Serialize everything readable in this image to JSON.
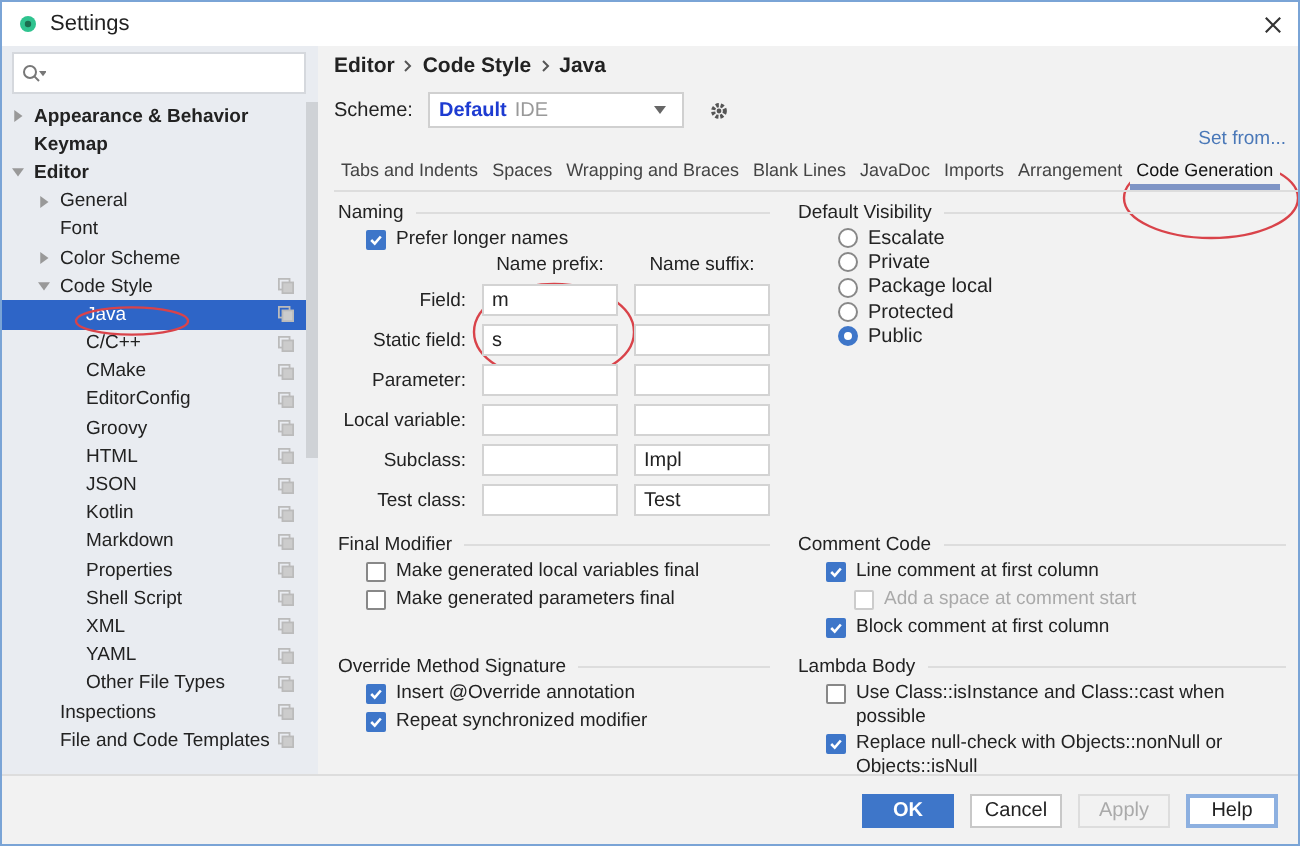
{
  "window": {
    "title": "Settings"
  },
  "sidebar": {
    "items": [
      {
        "label": "Appearance & Behavior",
        "expanded": false,
        "selected": false
      },
      {
        "label": "Keymap",
        "selected": false
      },
      {
        "label": "Editor",
        "expanded": true,
        "selected": false,
        "children": [
          {
            "label": "General",
            "expanded": false,
            "selected": false
          },
          {
            "label": "Font",
            "selected": false
          },
          {
            "label": "Color Scheme",
            "expanded": false,
            "selected": false
          },
          {
            "label": "Code Style",
            "expanded": true,
            "selected": false,
            "scheme_icon": true,
            "children": [
              {
                "label": "Java",
                "selected": true,
                "scheme_icon": true
              },
              {
                "label": "C/C++",
                "selected": false,
                "scheme_icon": true
              },
              {
                "label": "CMake",
                "selected": false,
                "scheme_icon": true
              },
              {
                "label": "EditorConfig",
                "selected": false,
                "scheme_icon": true
              },
              {
                "label": "Groovy",
                "selected": false,
                "scheme_icon": true
              },
              {
                "label": "HTML",
                "selected": false,
                "scheme_icon": true
              },
              {
                "label": "JSON",
                "selected": false,
                "scheme_icon": true
              },
              {
                "label": "Kotlin",
                "selected": false,
                "scheme_icon": true
              },
              {
                "label": "Markdown",
                "selected": false,
                "scheme_icon": true
              },
              {
                "label": "Properties",
                "selected": false,
                "scheme_icon": true
              },
              {
                "label": "Shell Script",
                "selected": false,
                "scheme_icon": true
              },
              {
                "label": "XML",
                "selected": false,
                "scheme_icon": true
              },
              {
                "label": "YAML",
                "selected": false,
                "scheme_icon": true
              },
              {
                "label": "Other File Types",
                "selected": false,
                "scheme_icon": true
              }
            ]
          },
          {
            "label": "Inspections",
            "selected": false,
            "scheme_icon": true
          },
          {
            "label": "File and Code Templates",
            "selected": false,
            "scheme_icon": true
          }
        ]
      }
    ]
  },
  "breadcrumb": [
    "Editor",
    "Code Style",
    "Java"
  ],
  "scheme": {
    "label": "Scheme:",
    "name": "Default",
    "tag": "IDE"
  },
  "set_from": "Set from...",
  "tabs": [
    {
      "label": "Tabs and Indents",
      "selected": false
    },
    {
      "label": "Spaces",
      "selected": false
    },
    {
      "label": "Wrapping and Braces",
      "selected": false
    },
    {
      "label": "Blank Lines",
      "selected": false
    },
    {
      "label": "JavaDoc",
      "selected": false
    },
    {
      "label": "Imports",
      "selected": false
    },
    {
      "label": "Arrangement",
      "selected": false
    },
    {
      "label": "Code Generation",
      "selected": true
    }
  ],
  "naming": {
    "title": "Naming",
    "prefer_longer": {
      "label": "Prefer longer names",
      "checked": true
    },
    "headers": [
      "Name prefix:",
      "Name suffix:"
    ],
    "rows": [
      {
        "label": "Field:",
        "prefix": "m",
        "suffix": ""
      },
      {
        "label": "Static field:",
        "prefix": "s",
        "suffix": ""
      },
      {
        "label": "Parameter:",
        "prefix": "",
        "suffix": ""
      },
      {
        "label": "Local variable:",
        "prefix": "",
        "suffix": ""
      },
      {
        "label": "Subclass:",
        "prefix": "",
        "suffix": "Impl"
      },
      {
        "label": "Test class:",
        "prefix": "",
        "suffix": "Test"
      }
    ]
  },
  "default_visibility": {
    "title": "Default Visibility",
    "options": [
      {
        "label": "Escalate",
        "selected": false
      },
      {
        "label": "Private",
        "selected": false
      },
      {
        "label": "Package local",
        "selected": false
      },
      {
        "label": "Protected",
        "selected": false
      },
      {
        "label": "Public",
        "selected": true
      }
    ]
  },
  "sections": [
    {
      "title": "Final Modifier",
      "options": [
        {
          "label": "Make generated local variables final",
          "checked": false,
          "disabled": false,
          "indented": false
        },
        {
          "label": "Make generated parameters final",
          "checked": false,
          "disabled": false,
          "indented": false
        }
      ]
    },
    {
      "title": "Comment Code",
      "options": [
        {
          "label": "Line comment at first column",
          "checked": true,
          "disabled": false,
          "indented": false
        },
        {
          "label": "Add a space at comment start",
          "checked": false,
          "disabled": true,
          "indented": true
        },
        {
          "label": "Block comment at first column",
          "checked": true,
          "disabled": false,
          "indented": false
        }
      ]
    },
    {
      "title": "Override Method Signature",
      "options": [
        {
          "label": "Insert @Override annotation",
          "checked": true,
          "disabled": false,
          "indented": false
        },
        {
          "label": "Repeat synchronized modifier",
          "checked": true,
          "disabled": false,
          "indented": false
        }
      ]
    },
    {
      "title": "Lambda Body",
      "options": [
        {
          "label": "Use Class::isInstance and Class::cast when possible",
          "checked": false,
          "disabled": false,
          "indented": false
        },
        {
          "label": "Replace null-check with Objects::nonNull or Objects::isNull",
          "checked": true,
          "disabled": false,
          "indented": false
        }
      ]
    }
  ],
  "buttons": [
    {
      "label": "OK",
      "kind": "primary"
    },
    {
      "label": "Cancel",
      "kind": "normal"
    },
    {
      "label": "Apply",
      "kind": "disabled"
    },
    {
      "label": "Help",
      "kind": "focused"
    }
  ]
}
